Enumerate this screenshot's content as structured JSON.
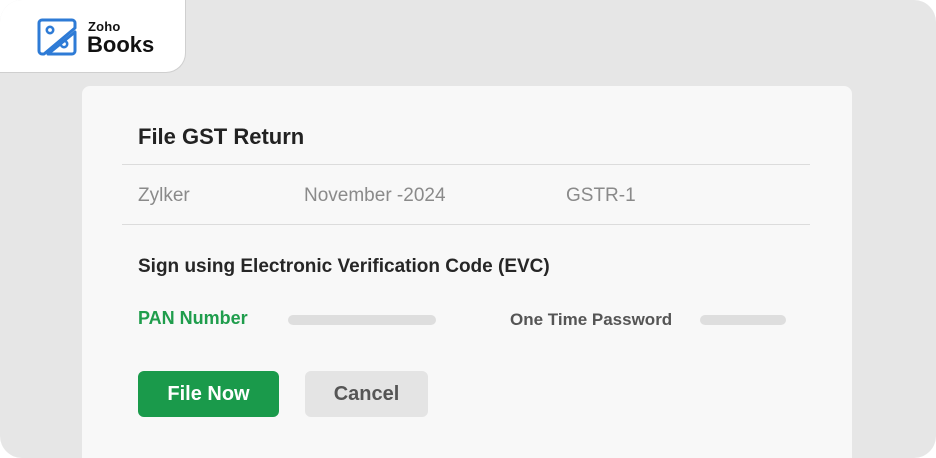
{
  "brand": {
    "small": "Zoho",
    "large": "Books",
    "icon": "zoho-books-logo-icon",
    "accent": "#2e7bd6"
  },
  "dialog": {
    "title": "File GST Return",
    "organization": "Zylker",
    "period": "November -2024",
    "return_type": "GSTR-1",
    "section_heading": "Sign using Electronic Verification Code (EVC)",
    "pan_label": "PAN Number",
    "otp_label": "One Time Password",
    "file_button": "File Now",
    "cancel_button": "Cancel"
  },
  "colors": {
    "primary": "#1a9a4b",
    "pan_label": "#1f9d4c",
    "background": "#e6e6e6",
    "card": "#f8f8f8"
  }
}
